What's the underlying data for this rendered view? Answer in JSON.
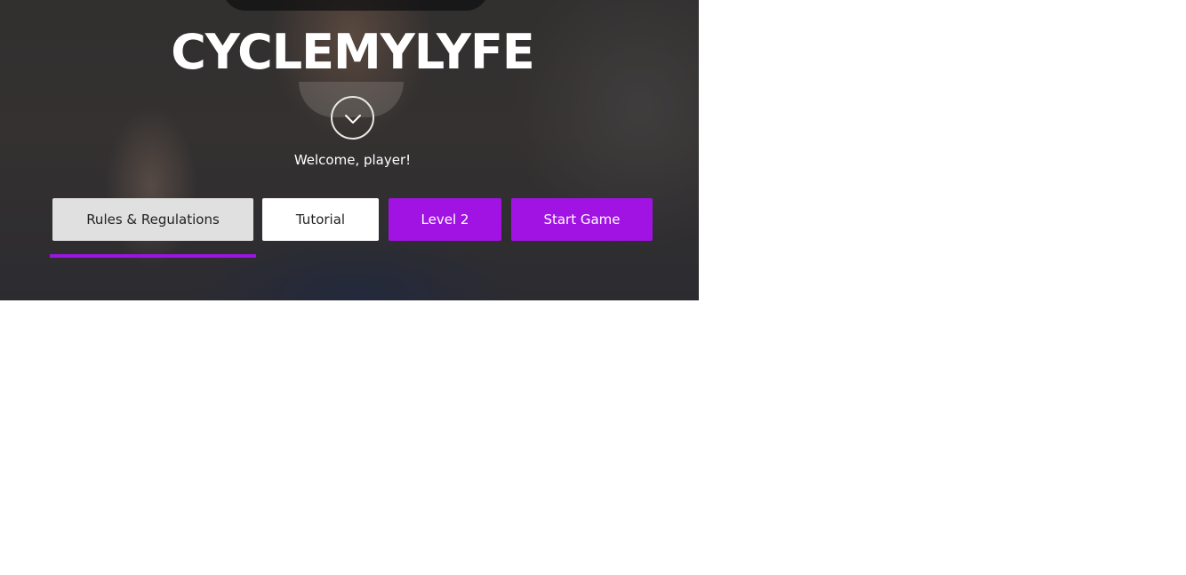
{
  "hero": {
    "title": "CYCLEMYLYFE",
    "welcome_text": "Welcome, player!",
    "scroll_icon": "chevron-down-icon"
  },
  "nav": {
    "buttons": [
      {
        "label": "Rules & Regulations",
        "state": "active"
      },
      {
        "label": "Tutorial",
        "state": "default"
      },
      {
        "label": "Level 2",
        "state": "primary"
      },
      {
        "label": "Start Game",
        "state": "primary"
      }
    ]
  },
  "colors": {
    "accent": "#a013e3",
    "active_tab_bg": "#e0e0e0",
    "text_light": "#ffffff"
  }
}
